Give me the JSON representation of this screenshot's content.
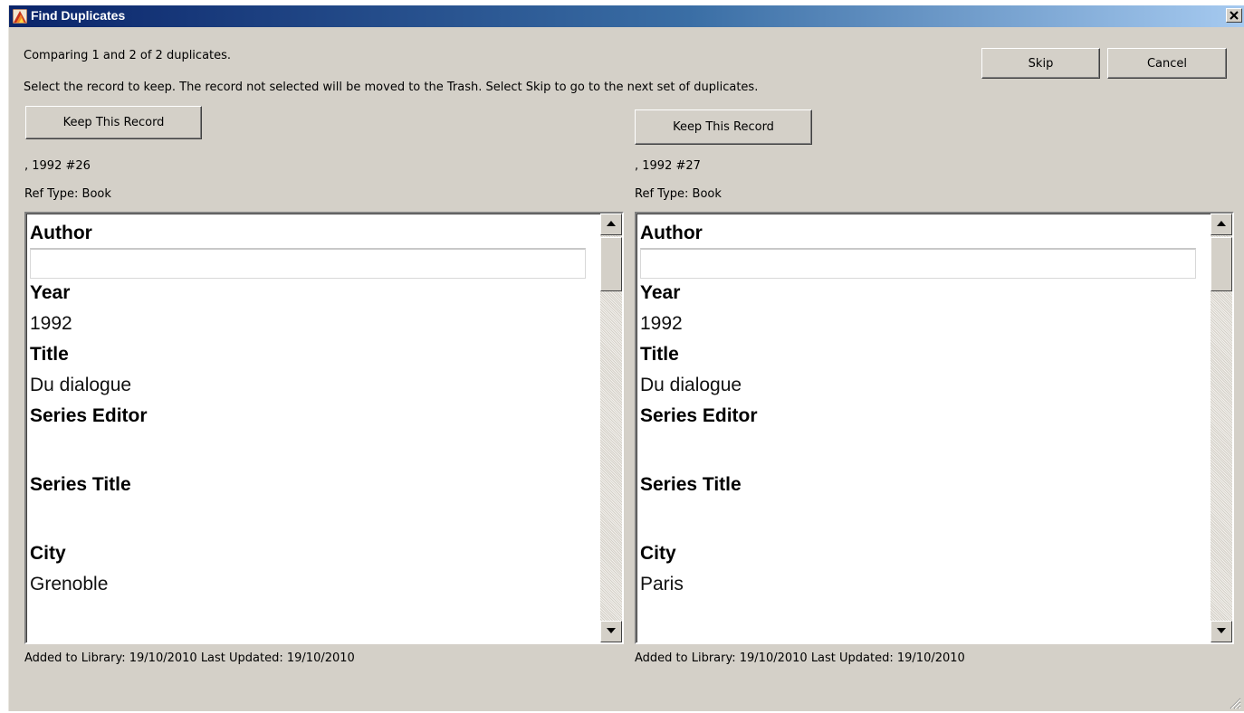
{
  "window": {
    "title": "Find Duplicates"
  },
  "header": {
    "comparing_text": "Comparing 1 and 2 of 2 duplicates.",
    "instruction_text": "Select the record to keep. The record not selected will be moved to the Trash. Select Skip to go to the next set of duplicates.",
    "skip_label": "Skip",
    "cancel_label": "Cancel"
  },
  "left": {
    "keep_label": "Keep This Record",
    "ref_id": ", 1992 #26",
    "ref_type": "Ref Type: Book",
    "fields": {
      "author_label": "Author",
      "author_value": "",
      "year_label": "Year",
      "year_value": "1992",
      "title_label": "Title",
      "title_value": "Du dialogue",
      "series_editor_label": "Series Editor",
      "series_editor_value": "",
      "series_title_label": "Series Title",
      "series_title_value": "",
      "city_label": "City",
      "city_value": "Grenoble"
    },
    "footer": "Added to Library: 19/10/2010    Last Updated: 19/10/2010"
  },
  "right": {
    "keep_label": "Keep This Record",
    "ref_id": ", 1992 #27",
    "ref_type": "Ref Type: Book",
    "fields": {
      "author_label": "Author",
      "author_value": "",
      "year_label": "Year",
      "year_value": "1992",
      "title_label": "Title",
      "title_value": "Du dialogue",
      "series_editor_label": "Series Editor",
      "series_editor_value": "",
      "series_title_label": "Series Title",
      "series_title_value": "",
      "city_label": "City",
      "city_value": "Paris"
    },
    "footer": "Added to Library: 19/10/2010    Last Updated: 19/10/2010"
  },
  "icons": {
    "app": "endnote-app-icon",
    "close": "close-icon",
    "scroll_up": "triangle-up-icon",
    "scroll_down": "triangle-down-icon",
    "resize": "resize-grip-icon"
  },
  "colors": {
    "titlebar_start": "#0a246a",
    "titlebar_end": "#a6caf0",
    "dialog_bg": "#d4d0c8"
  }
}
